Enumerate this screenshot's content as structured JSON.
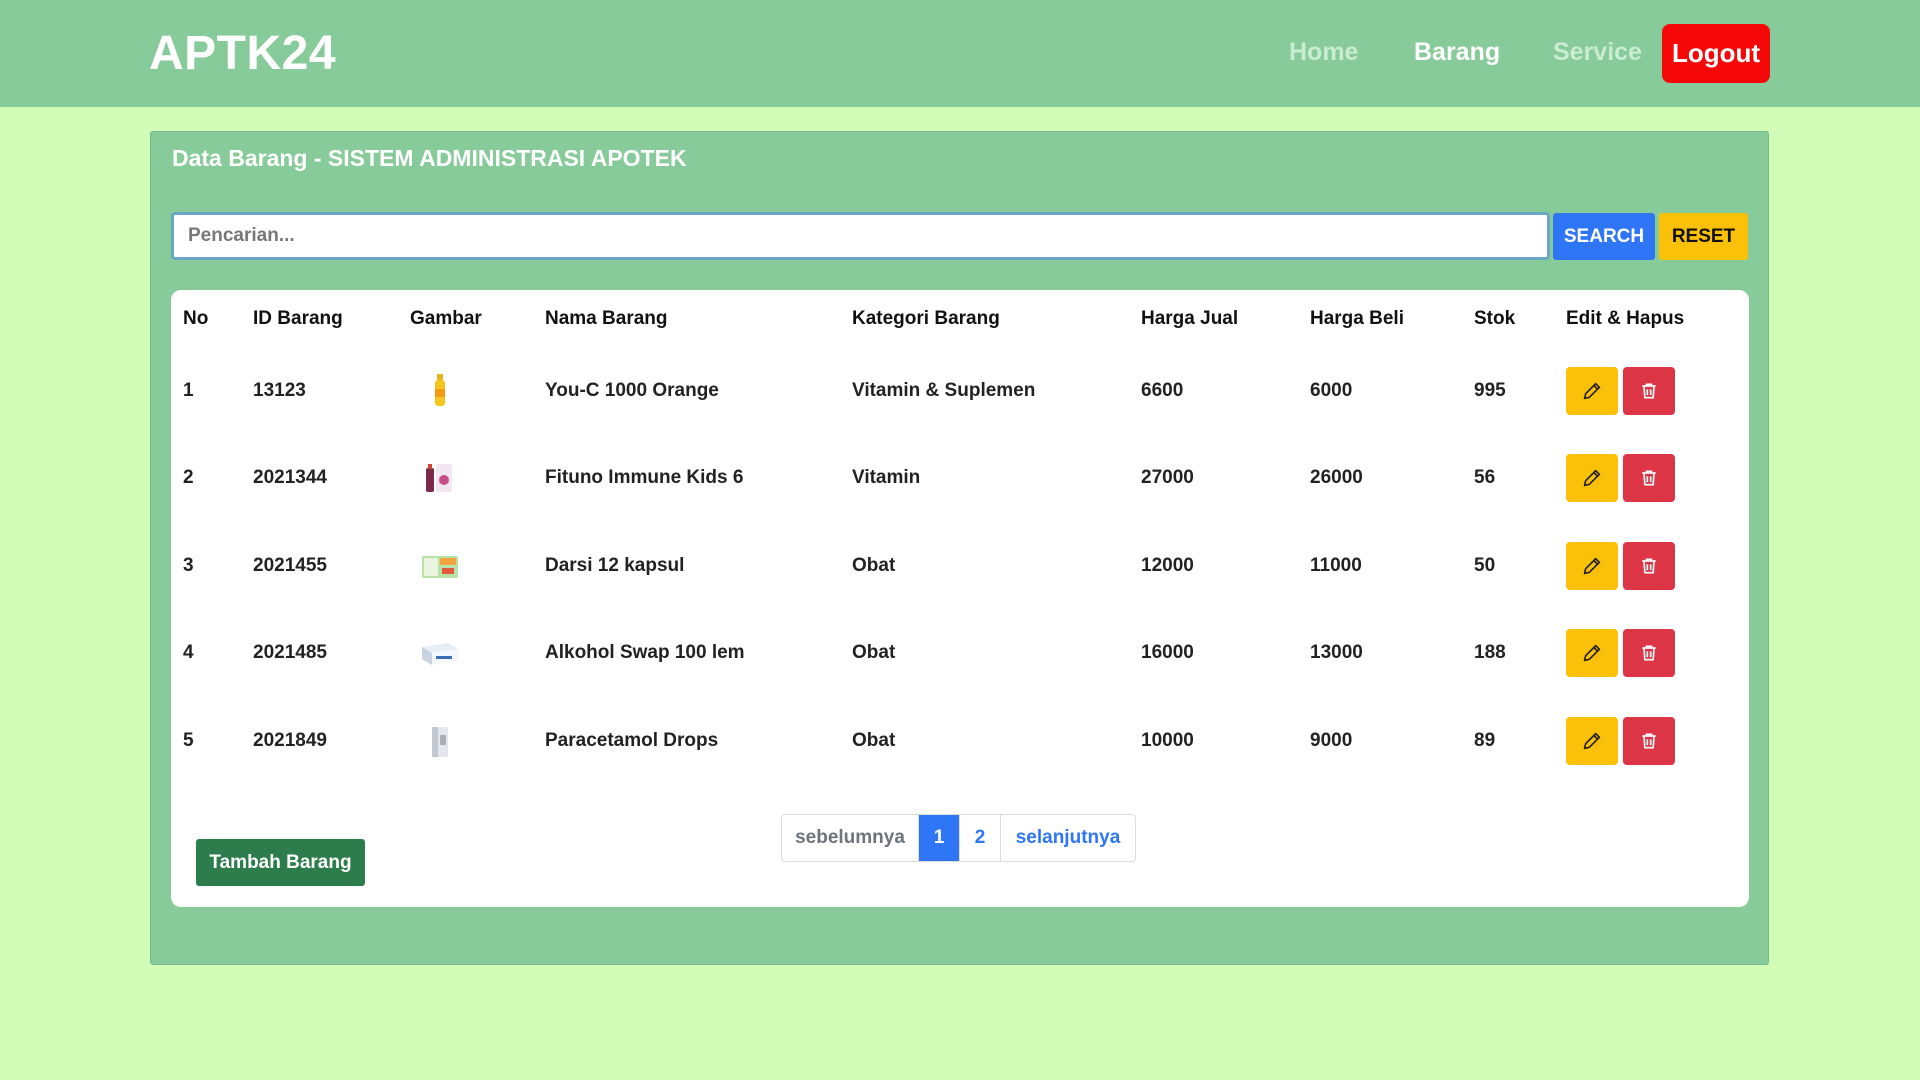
{
  "app": {
    "brand": "APTK24"
  },
  "nav": {
    "home": "Home",
    "barang": "Barang",
    "service": "Service",
    "logout": "Logout"
  },
  "panel": {
    "title": "Data Barang - SISTEM ADMINISTRASI APOTEK"
  },
  "search": {
    "placeholder": "Pencarian...",
    "value": "",
    "search_label": "SEARCH",
    "reset_label": "RESET"
  },
  "table": {
    "headers": [
      "No",
      "ID Barang",
      "Gambar",
      "Nama Barang",
      "Kategori Barang",
      "Harga Jual",
      "Harga Beli",
      "Stok",
      "Edit & Hapus"
    ],
    "rows": [
      {
        "no": "1",
        "id": "13123",
        "image": "vitamin-bottle-image",
        "nama": "You-C 1000 Orange",
        "kategori": "Vitamin & Suplemen",
        "jual": "6600",
        "beli": "6000",
        "stok": "995"
      },
      {
        "no": "2",
        "id": "2021344",
        "image": "syrup-box-image",
        "nama": "Fituno Immune Kids 6",
        "kategori": "Vitamin",
        "jual": "27000",
        "beli": "26000",
        "stok": "56"
      },
      {
        "no": "3",
        "id": "2021455",
        "image": "capsule-pack-image",
        "nama": "Darsi 12 kapsul",
        "kategori": "Obat",
        "jual": "12000",
        "beli": "11000",
        "stok": "50"
      },
      {
        "no": "4",
        "id": "2021485",
        "image": "swab-box-image",
        "nama": "Alkohol Swap 100 lem",
        "kategori": "Obat",
        "jual": "16000",
        "beli": "13000",
        "stok": "188"
      },
      {
        "no": "5",
        "id": "2021849",
        "image": "drops-bottle-image",
        "nama": "Paracetamol Drops",
        "kategori": "Obat",
        "jual": "10000",
        "beli": "9000",
        "stok": "89"
      }
    ]
  },
  "actions": {
    "add_label": "Tambah Barang"
  },
  "pagination": {
    "prev": "sebelumnya",
    "pages": [
      "1",
      "2"
    ],
    "active": "1",
    "next": "selanjutnya"
  },
  "colors": {
    "nav_bg": "#88cb9a",
    "page_bg": "#d0fcb8",
    "primary": "#2f76f6",
    "warning": "#fbc108",
    "danger": "#dc3545",
    "logout": "#f70808",
    "success": "#2c7d4b"
  }
}
